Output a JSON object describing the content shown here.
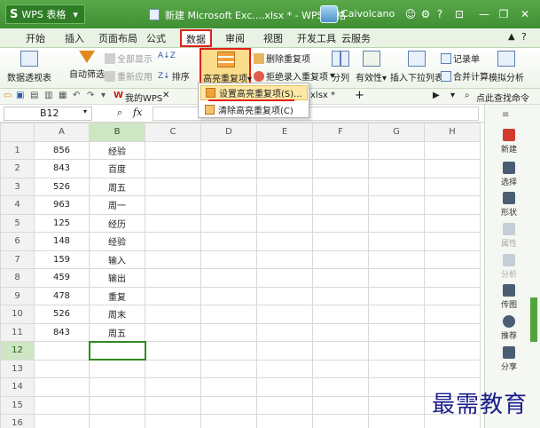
{
  "app": {
    "button_label": "WPS 表格",
    "window_title": "新建 Microsoft Exc....xlsx * - WPS 表格",
    "user": "Caivolcano"
  },
  "menu_tabs": [
    "开始",
    "插入",
    "页面布局",
    "公式",
    "数据",
    "审阅",
    "视图",
    "开发工具",
    "云服务"
  ],
  "active_tab": "数据",
  "ribbon": {
    "pivot": "数据透视表",
    "autofilter": "自动筛选",
    "show_all": "全部显示",
    "reapply": "重新应用",
    "sort": "排序",
    "highlight_dup": "高亮重复项",
    "delete_dup": "删除重复项",
    "reject_dup": "拒绝录入重复项",
    "split": "分列",
    "validity": "有效性",
    "insert_dropdown": "插入下拉列表",
    "record_form": "记录单",
    "consolidate": "合并计算",
    "whatif": "模拟分析"
  },
  "dropdown": {
    "set_highlight": "设置高亮重复项(S)...",
    "clear_highlight": "清除高亮重复项(C)"
  },
  "quick_access": {
    "my_wps": "我的WPS",
    "doc_tab": "xlsx *",
    "add": "+",
    "search": "点此查找命令"
  },
  "formula_bar": {
    "cell_ref": "B12",
    "fx": "fx"
  },
  "columns": [
    "A",
    "B",
    "C",
    "D",
    "E",
    "F",
    "G",
    "H"
  ],
  "rows": [
    {
      "n": "1",
      "a": "856",
      "b": "经验"
    },
    {
      "n": "2",
      "a": "843",
      "b": "百度"
    },
    {
      "n": "3",
      "a": "526",
      "b": "周五"
    },
    {
      "n": "4",
      "a": "963",
      "b": "周一"
    },
    {
      "n": "5",
      "a": "125",
      "b": "经历"
    },
    {
      "n": "6",
      "a": "148",
      "b": "经验"
    },
    {
      "n": "7",
      "a": "159",
      "b": "输入"
    },
    {
      "n": "8",
      "a": "459",
      "b": "输出"
    },
    {
      "n": "9",
      "a": "478",
      "b": "重复"
    },
    {
      "n": "10",
      "a": "526",
      "b": "周末"
    },
    {
      "n": "11",
      "a": "843",
      "b": "周五"
    },
    {
      "n": "12",
      "a": "",
      "b": ""
    },
    {
      "n": "13",
      "a": "",
      "b": ""
    },
    {
      "n": "14",
      "a": "",
      "b": ""
    },
    {
      "n": "15",
      "a": "",
      "b": ""
    },
    {
      "n": "16",
      "a": "",
      "b": ""
    }
  ],
  "task_pane": [
    "新建",
    "选择",
    "形状",
    "属性",
    "分析",
    "传图",
    "推荐",
    "分享"
  ],
  "watermark": "最需教育"
}
